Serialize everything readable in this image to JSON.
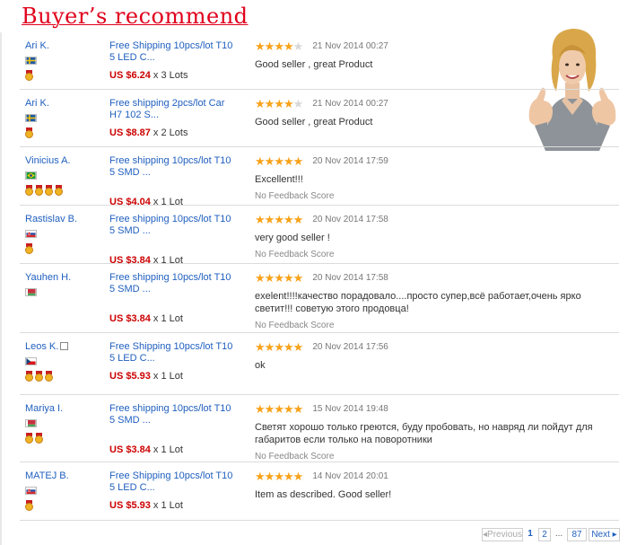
{
  "header": {
    "title": "Buyer’s recommend"
  },
  "reviews": [
    {
      "buyer": "Ari K.",
      "country": "SE",
      "medals": 1,
      "product": "Free Shipping 10pcs/lot T10 5 LED C...",
      "price": "US $6.24",
      "qty": " x 3 Lots",
      "stars": 4,
      "date": "21 Nov 2014 00:27",
      "comment": "Good seller , great Product",
      "no_score": ""
    },
    {
      "buyer": "Ari K.",
      "country": "SE",
      "medals": 1,
      "product": "Free shipping 2pcs/lot Car H7 102 S...",
      "price": "US $8.87",
      "qty": " x 2 Lots",
      "stars": 4,
      "date": "21 Nov 2014 00:27",
      "comment": "Good seller , great Product",
      "no_score": ""
    },
    {
      "buyer": "Vinicius A.",
      "country": "BR",
      "medals": 4,
      "product": "Free shipping 10pcs/lot T10 5 SMD ...",
      "price": "US $4.04",
      "qty": " x 1 Lot",
      "stars": 5,
      "date": "20 Nov 2014 17:59",
      "comment": "Excellent!!!",
      "no_score": "No Feedback Score"
    },
    {
      "buyer": "Rastislav B.",
      "country": "SK",
      "medals": 1,
      "product": "Free shipping 10pcs/lot T10 5 SMD ...",
      "price": "US $3.84",
      "qty": " x 1 Lot",
      "stars": 5,
      "date": "20 Nov 2014 17:58",
      "comment": "very good seller !",
      "no_score": "No Feedback Score"
    },
    {
      "buyer": "Yauhen H.",
      "country": "BY",
      "medals": 0,
      "product": "Free shipping 10pcs/lot T10 5 SMD ...",
      "price": "US $3.84",
      "qty": " x 1 Lot",
      "stars": 5,
      "date": "20 Nov 2014 17:58",
      "comment": "exelent!!!!качество порадовало....просто супер,всё работает,очень ярко светит!!! советую этого продовца!",
      "no_score": "No Feedback Score"
    },
    {
      "buyer": "Leos K.",
      "country": "CZ",
      "medals": 3,
      "product": "Free Shipping 10pcs/lot T10 5 LED C...",
      "price": "US $5.93",
      "qty": " x 1 Lot",
      "stars": 5,
      "date": "20 Nov 2014 17:56",
      "comment": "ok",
      "no_score": ""
    },
    {
      "buyer": "Mariya I.",
      "country": "BY",
      "medals": 2,
      "product": "Free shipping 10pcs/lot T10 5 SMD ...",
      "price": "US $3.84",
      "qty": " x 1 Lot",
      "stars": 5,
      "date": "15 Nov 2014 19:48",
      "comment": "Светят хорошо только греются, буду пробовать, но навряд ли пойдут для габаритов если только на поворотники",
      "no_score": "No Feedback Score"
    },
    {
      "buyer": "MATEJ B.",
      "country": "SK",
      "medals": 1,
      "product": "Free Shipping 10pcs/lot T10 5 LED C...",
      "price": "US $5.93",
      "qty": " x 1 Lot",
      "stars": 5,
      "date": "14 Nov 2014 20:01",
      "comment": "Item as described. Good seller!",
      "no_score": ""
    }
  ],
  "pagination": {
    "previous": "◂Previous",
    "pages": [
      "1",
      "2"
    ],
    "ellipsis": "...",
    "last": "87",
    "next": "Next ▸"
  },
  "colors": {
    "title": "#e0001b",
    "link": "#1f5fbf",
    "price": "#cc0000",
    "star": "#f7a21a"
  }
}
